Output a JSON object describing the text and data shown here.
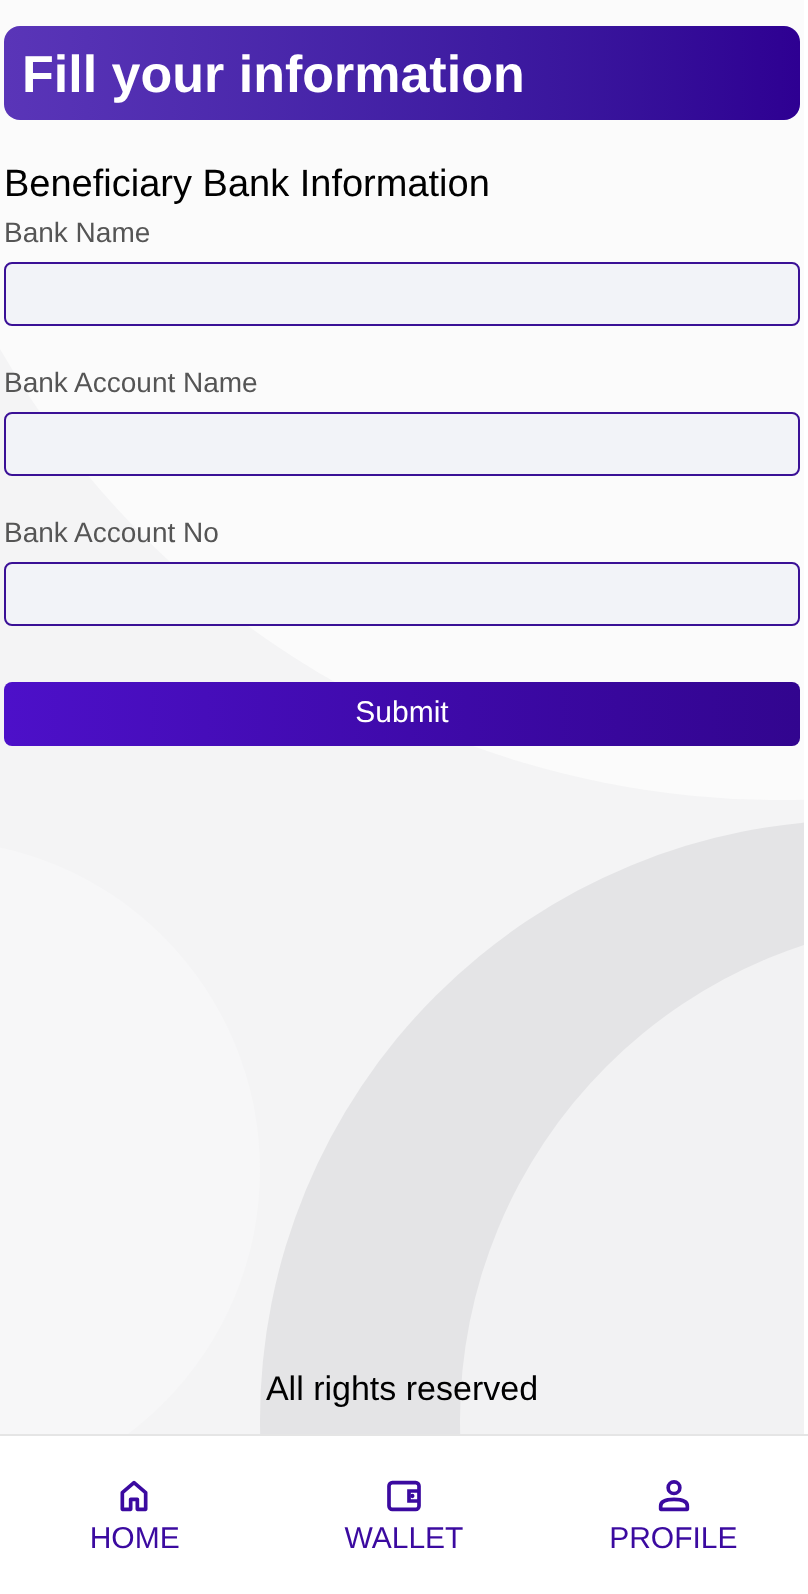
{
  "header": {
    "title": "Fill your information"
  },
  "section_title": "Beneficiary Bank Information",
  "fields": [
    {
      "label": "Bank Name"
    },
    {
      "label": "Bank Account Name"
    },
    {
      "label": "Bank Account No"
    }
  ],
  "submit": "Submit",
  "footer": "All rights reserved",
  "nav": [
    {
      "kind": "home",
      "label": "HOME"
    },
    {
      "kind": "wallet",
      "label": "WALLET"
    },
    {
      "kind": "profile",
      "label": "PROFILE"
    }
  ]
}
